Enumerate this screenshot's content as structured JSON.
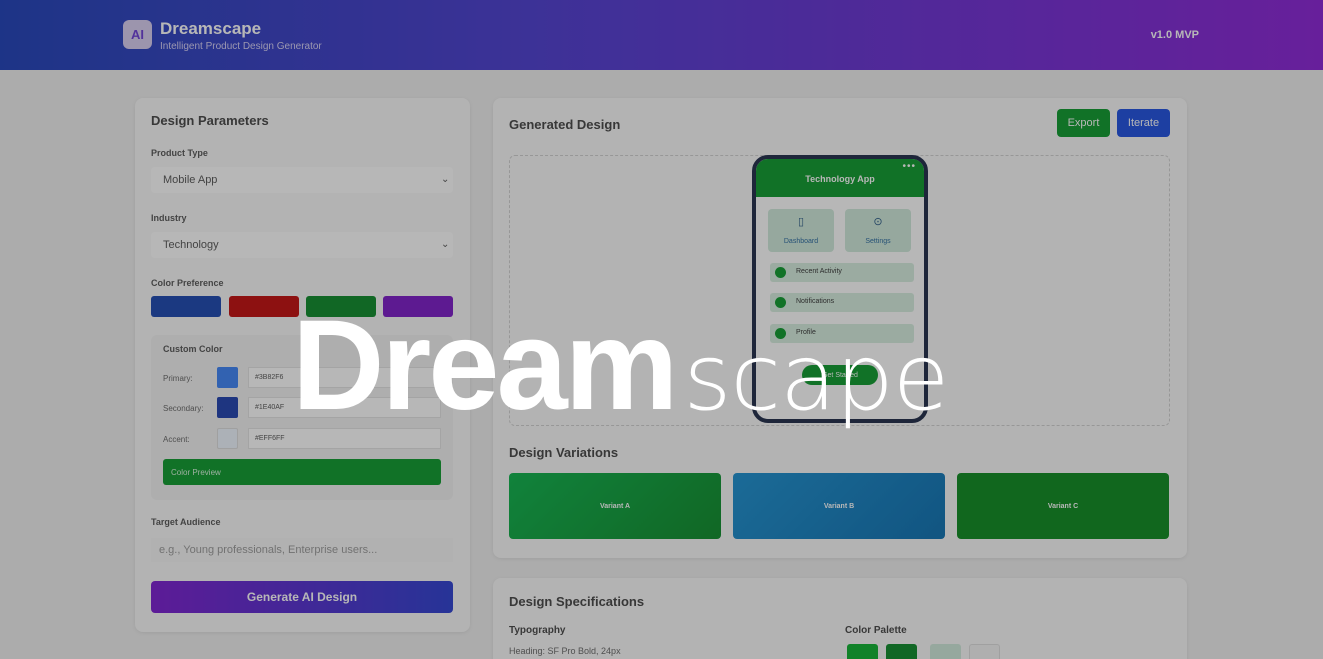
{
  "header": {
    "logo": "AI",
    "app_name": "Dreamscape",
    "tagline": "Intelligent Product Design Generator",
    "version": "v1.0 MVP"
  },
  "params": {
    "title": "Design Parameters",
    "product_type_label": "Product Type",
    "product_type_value": "Mobile App",
    "industry_label": "Industry",
    "industry_value": "Technology",
    "color_pref_label": "Color Preference",
    "color_swatches": [
      "#1a46b0",
      "#c20b0b",
      "#0b8a28",
      "#7b18c8"
    ],
    "custom_color_label": "Custom Color",
    "primary_label": "Primary:",
    "primary_hex": "#3B82F6",
    "secondary_label": "Secondary:",
    "secondary_hex": "#1E40AF",
    "accent_label": "Accent:",
    "accent_hex": "#EFF6FF",
    "preview_label": "Color Preview",
    "audience_label": "Target Audience",
    "audience_placeholder": "e.g., Young professionals, Enterprise users...",
    "generate_label": "Generate AI Design"
  },
  "generated": {
    "title": "Generated Design",
    "export_label": "Export",
    "iterate_label": "Iterate",
    "phone": {
      "dots": "•••",
      "app_title": "Technology App",
      "tiles": [
        {
          "icon": "phone-icon",
          "label": "Dashboard"
        },
        {
          "icon": "gear-icon",
          "label": "Settings"
        }
      ],
      "list": [
        "Recent Activity",
        "Notifications",
        "Profile"
      ],
      "cta": "Get Started"
    },
    "variations_title": "Design Variations",
    "variants": [
      "Variant A",
      "Variant B",
      "Variant C"
    ]
  },
  "specs": {
    "title": "Design Specifications",
    "typography_label": "Typography",
    "heading_spec": "Heading: SF Pro Bold, 24px",
    "palette_label": "Color Palette",
    "palette": [
      "#0bb22e",
      "#0b8a28",
      "#cfe9da",
      "#f3f3f3"
    ]
  },
  "overlay": {
    "brand_bold": "Dream",
    "brand_light": "scape"
  }
}
